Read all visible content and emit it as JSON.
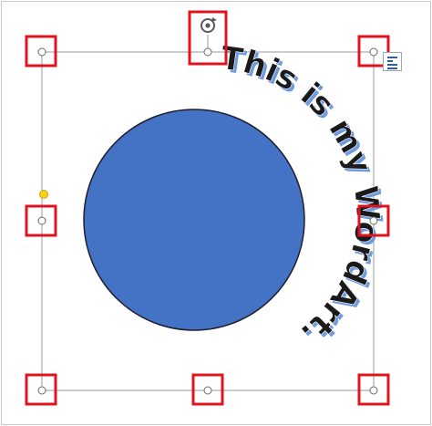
{
  "wordart": {
    "text": "This is my WordArt.",
    "fill_color": "#1a1a1a",
    "shadow_color": "#6e9be0",
    "shape_fill": "#4472c4",
    "shape_border": "#1f1f2e"
  },
  "selection": {
    "frame_color": "#999999",
    "handle_highlight_color": "#e0141e",
    "adjust_handle_color": "#f7d117"
  },
  "icons": {
    "rotate": "rotate-icon",
    "layout_options": "layout-options-icon"
  }
}
